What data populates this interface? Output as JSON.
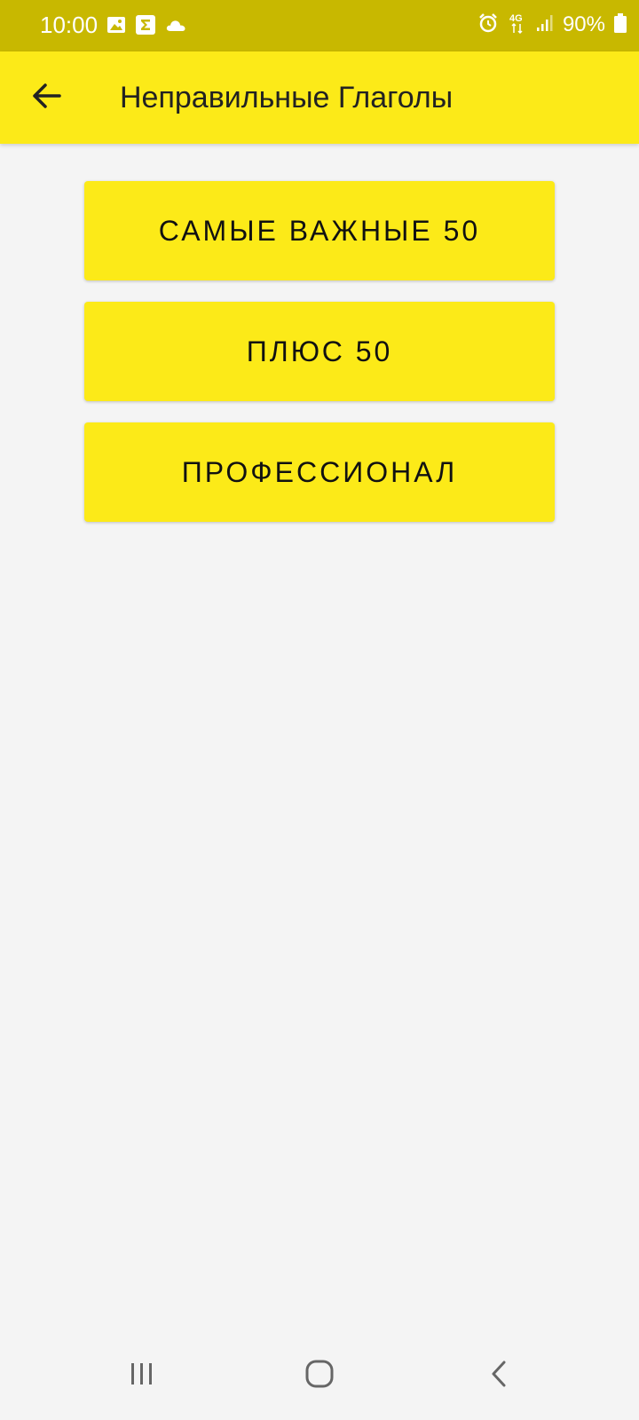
{
  "status_bar": {
    "time": "10:00",
    "left_icons": [
      "image-icon",
      "sigma-app-icon",
      "cloud-icon"
    ],
    "right_icons": [
      "alarm-icon",
      "network-4g-icon",
      "signal-icon"
    ],
    "battery_percent": "90%",
    "network_label": "4G"
  },
  "app_bar": {
    "title": "Неправильные Глаголы",
    "back_icon": "arrow-left-icon"
  },
  "menu": {
    "items": [
      {
        "label": "САМЫЕ ВАЖНЫЕ 50"
      },
      {
        "label": "ПЛЮС 50"
      },
      {
        "label": "ПРОФЕССИОНАЛ"
      }
    ]
  },
  "nav_bar": {
    "icons": [
      "recent-apps-icon",
      "home-icon",
      "back-icon"
    ]
  },
  "colors": {
    "status_bar": "#C8B800",
    "accent": "#FCEA18",
    "background": "#F4F4F4",
    "text": "#111111"
  }
}
